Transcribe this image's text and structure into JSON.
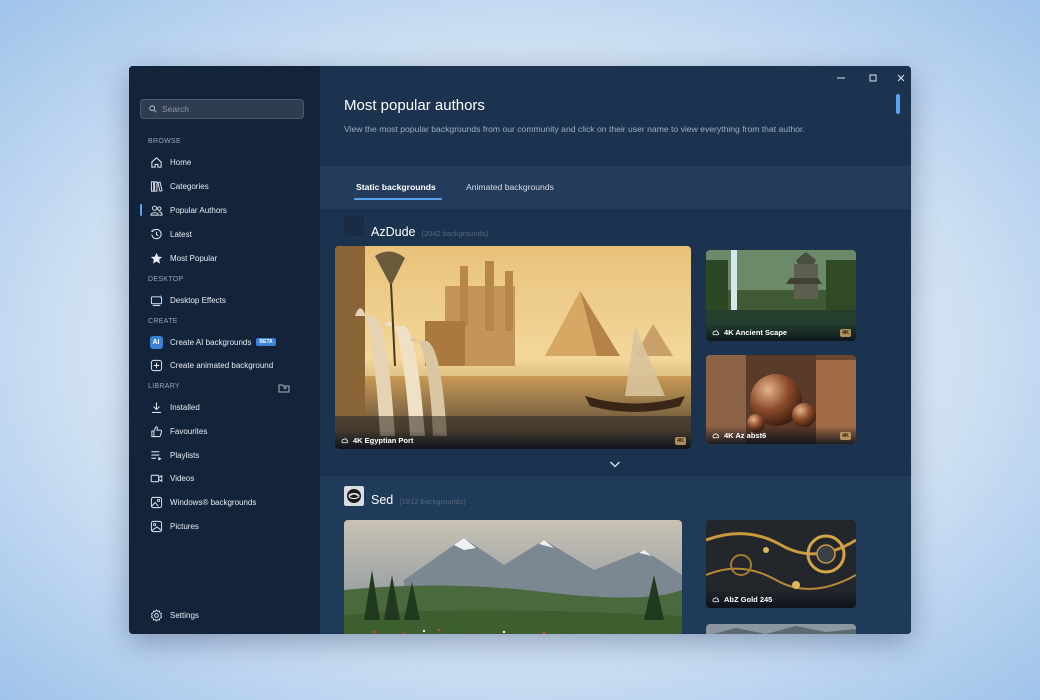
{
  "search": {
    "placeholder": "Search"
  },
  "sidebar": {
    "sections": {
      "browse": "BROWSE",
      "desktop": "DESKTOP",
      "create": "CREATE",
      "library": "LIBRARY"
    },
    "items": [
      {
        "label": "Home",
        "icon": "home-icon"
      },
      {
        "label": "Categories",
        "icon": "categories-icon"
      },
      {
        "label": "Popular Authors",
        "icon": "authors-icon",
        "active": true
      },
      {
        "label": "Latest",
        "icon": "latest-icon"
      },
      {
        "label": "Most Popular",
        "icon": "star-icon"
      },
      {
        "label": "Desktop Effects",
        "icon": "desktop-effects-icon"
      },
      {
        "label": "Create AI backgrounds",
        "icon": "ai-icon",
        "badge": "BETA",
        "badge_text": "AI"
      },
      {
        "label": "Create animated background",
        "icon": "plus-box-icon"
      },
      {
        "label": "Installed",
        "icon": "download-icon"
      },
      {
        "label": "Favourites",
        "icon": "thumbs-up-icon"
      },
      {
        "label": "Playlists",
        "icon": "playlist-icon"
      },
      {
        "label": "Videos",
        "icon": "video-icon"
      },
      {
        "label": "Windows® backgrounds",
        "icon": "image-icon"
      },
      {
        "label": "Pictures",
        "icon": "picture-icon"
      }
    ],
    "settings": "Settings"
  },
  "main": {
    "title": "Most popular authors",
    "description": "View the most popular backgrounds from our community and click on their user name to view everything from that author.",
    "tabs": [
      {
        "label": "Static backgrounds",
        "active": true
      },
      {
        "label": "Animated backgrounds",
        "active": false
      }
    ],
    "authors": [
      {
        "name": "AzDude",
        "count": "(2042 backgrounds)",
        "cards": [
          {
            "title": "4K Egyptian Port",
            "badge": "4K"
          },
          {
            "title": "4K Ancient Scape",
            "badge": "4K"
          },
          {
            "title": "4K Az abst6",
            "badge": "4K"
          }
        ]
      },
      {
        "name": "Sed",
        "count": "(1812 backgrounds)",
        "cards": [
          {
            "title": "AbZ Gold 245"
          }
        ]
      }
    ]
  },
  "colors": {
    "accent": "#5aa3f0",
    "sidebar_bg": "#12233a",
    "main_bg": "#1c3350"
  }
}
